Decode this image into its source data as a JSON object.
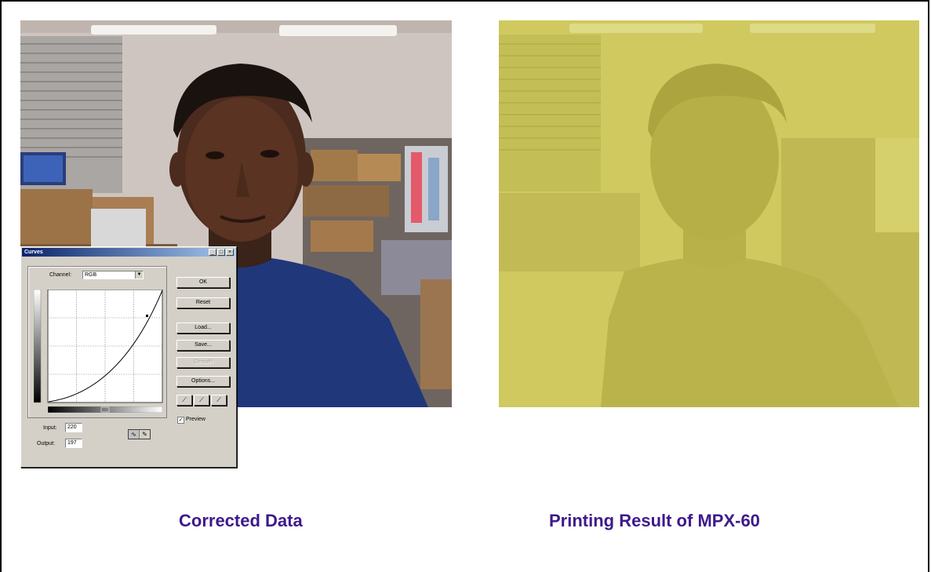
{
  "captions": {
    "corrected": "Corrected Data",
    "printing_result": "Printing Result of MPX-60"
  },
  "curves_dialog": {
    "title": "Curves",
    "window_buttons": [
      "_",
      "□",
      "×"
    ],
    "channel_label": "Channel:",
    "channel_value": "RGB",
    "input_label": "Input:",
    "input_value": "220",
    "output_label": "Output:",
    "output_value": "197",
    "buttons": {
      "ok": "OK",
      "reset": "Reset",
      "load": "Load...",
      "save": "Save...",
      "smooth": "Smooth",
      "options": "Options..."
    },
    "preview_label": "Preview",
    "preview_checked": true,
    "eyedropper_icons": [
      "black-eyedropper-icon",
      "gray-eyedropper-icon",
      "white-eyedropper-icon"
    ],
    "curve_tool_icons": [
      "curve-tool-icon",
      "pencil-tool-icon"
    ]
  },
  "colors": {
    "caption": "#3d1a8c",
    "print_tint": "#cfc960"
  }
}
